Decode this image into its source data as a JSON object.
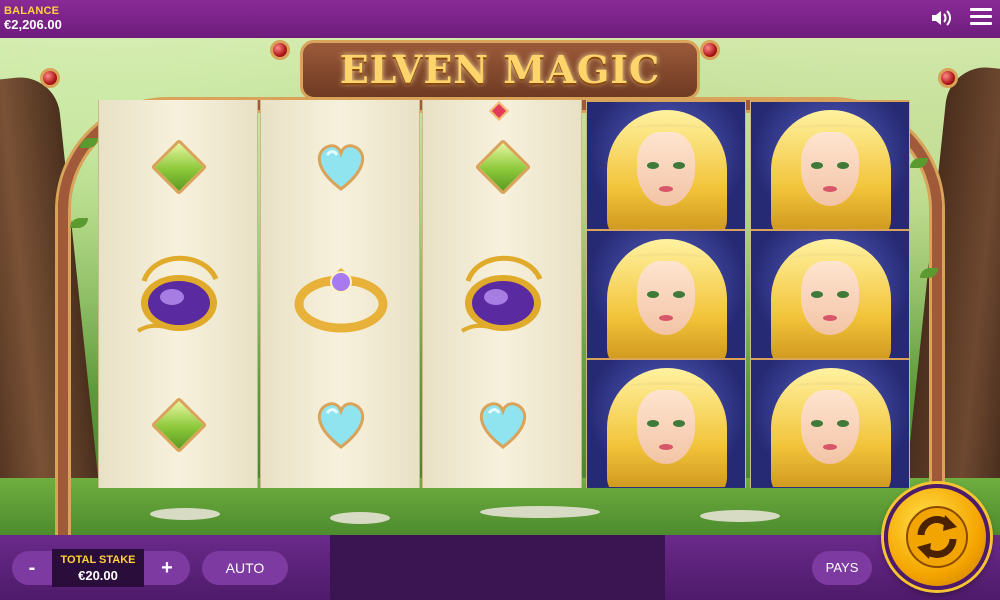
{
  "header": {
    "balance_label": "BALANCE",
    "balance_value": "€2,206.00",
    "sound_icon": "speaker-icon",
    "menu_icon": "hamburger-menu-icon"
  },
  "game": {
    "title": "ELVEN MAGIC",
    "reels": [
      [
        "green-diamond",
        "amulet",
        "green-diamond"
      ],
      [
        "blue-heart",
        "gold-ring",
        "blue-heart"
      ],
      [
        "green-diamond",
        "amulet",
        "blue-heart"
      ],
      [
        "elf-princess",
        "elf-princess",
        "elf-princess"
      ],
      [
        "elf-princess",
        "elf-princess",
        "elf-princess"
      ]
    ]
  },
  "controls": {
    "minus_label": "-",
    "plus_label": "+",
    "stake_label": "TOTAL STAKE",
    "stake_value": "€20.00",
    "auto_label": "AUTO",
    "pays_label": "PAYS",
    "spin_icon": "spin-arrows-icon"
  },
  "colors": {
    "bar_purple": "#6d1c7c",
    "gold": "#ffd23a",
    "spin_orange": "#f5a500"
  }
}
